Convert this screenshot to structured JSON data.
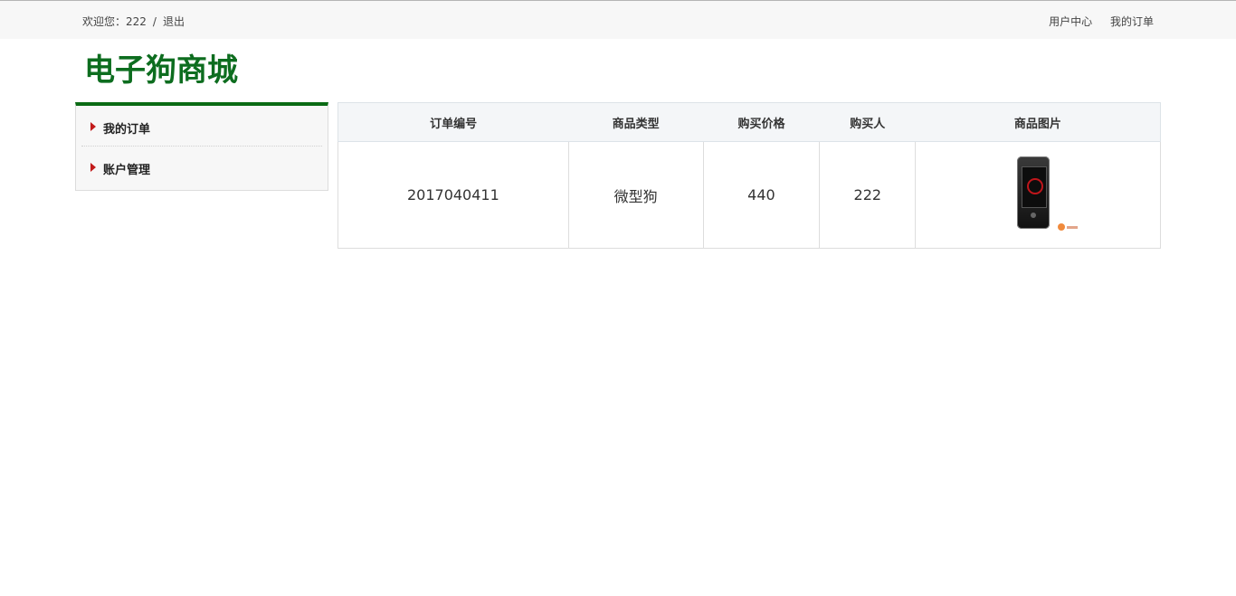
{
  "topbar": {
    "welcome_prefix": "欢迎您：222",
    "separator": "/",
    "logout": "退出",
    "links": [
      "用户中心",
      "我的订单"
    ]
  },
  "logo": "电子狗商城",
  "sidebar": {
    "items": [
      {
        "label": "我的订单",
        "icon": "triangle-right-icon"
      },
      {
        "label": "账户管理",
        "icon": "triangle-right-icon"
      }
    ]
  },
  "orders": {
    "headers": [
      "订单编号",
      "商品类型",
      "购买价格",
      "购买人",
      "商品图片"
    ],
    "rows": [
      {
        "order_id": "2017040411",
        "type": "微型狗",
        "price": "440",
        "buyer": "222",
        "image_icon": "phone-product-icon"
      }
    ]
  },
  "colors": {
    "brand": "#0d6d1f",
    "arrow": "#c21a1a",
    "sidebar_top": "#0a6b14"
  }
}
